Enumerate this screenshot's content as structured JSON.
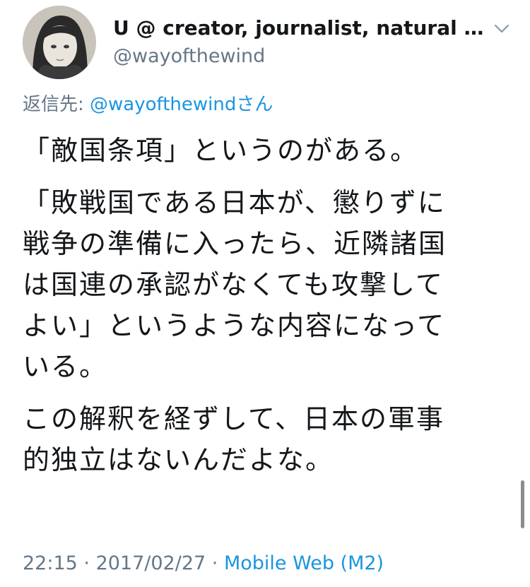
{
  "tweet": {
    "author_name": "U @ creator, journalist, natural pe...",
    "author_handle": "@wayofthewind",
    "reply_prefix": "返信先: ",
    "reply_handle": "@wayofthewindさん",
    "paragraphs": [
      "「敵国条項」というのがある。",
      "「敗戦国である日本が、懲りずに\n戦争の準備に入ったら、近隣諸国\nは国連の承認がなくても攻撃して\nよい」というような内容になって\nいる。",
      "この解釈を経ずして、日本の軍事\n的独立はないんだよな。"
    ],
    "time": "22:15",
    "separator": " · ",
    "date": "2017/02/27",
    "source": "Mobile Web (M2)"
  },
  "colors": {
    "text": "#14171a",
    "secondary": "#657786",
    "link": "#1b95e0"
  },
  "icons": {
    "avatar": "avatar-illustration",
    "menu": "chevron-down-icon"
  }
}
